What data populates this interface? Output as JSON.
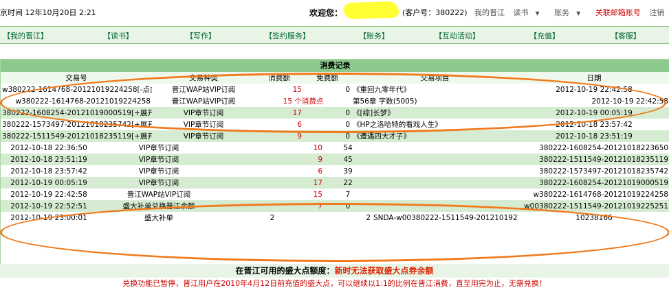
{
  "header": {
    "left_text": "京时间  12年10月20日  2:21",
    "welcome": "欢迎您：",
    "customer": "(客户号：380222)",
    "links": [
      "我的晋江",
      "读书",
      "账务",
      "关联邮箱账号",
      "注销"
    ]
  },
  "nav": [
    "【我的晋江】",
    "【读书】",
    "【写作】",
    "【签约服务】",
    "【账务】",
    "【互动活动】",
    "【充值】",
    "【客服】"
  ],
  "section": {
    "title": "消费记录",
    "headers": [
      "交易号",
      "交易种类",
      "消费额",
      "免费额",
      "交易项目",
      "日期"
    ],
    "records": [
      {
        "id": "w380222-1614768-20121019224258[-点击收起]",
        "type": "晋江WAP站VIP订阅",
        "spend": "15",
        "free": "0",
        "item": "《重回九零年代》",
        "date": "2012-10-19 22:42:58"
      },
      {
        "id": "w380222-1614768-20121019224258",
        "type": "晋江WAP站VIP订阅",
        "spend": "15 个消费点",
        "free": "",
        "item": "第56章  字数(5005)",
        "date": "2012-10-19 22:42:58"
      },
      {
        "id": "380222-1608254-20121019000519[+展开细节]",
        "type": "VIP章节订阅",
        "spend": "17",
        "free": "0",
        "item": "《[综]长梦》",
        "date": "2012-10-19 00:05:19"
      },
      {
        "id": "380222-1573497-20121018235742[+展开细节]",
        "type": "VIP章节订阅",
        "spend": "6",
        "free": "0",
        "item": "《HP之洛哈特的看戏人生》",
        "date": "2012-10-18 23:57:42"
      },
      {
        "id": "380222-1511549-20121018235119[+展开细节]",
        "type": "VIP章节订阅",
        "spend": "9",
        "free": "0",
        "item": "《遭遇四大才子》",
        "date": "2012-10-18 23:51:19"
      }
    ],
    "ledger": [
      {
        "date": "2012-10-18 22:36:50",
        "type": "VIP章节订阅",
        "spend": "10",
        "balance": "54",
        "id": "380222-1608254-20121018223650"
      },
      {
        "date": "2012-10-18 23:51:19",
        "type": "VIP章节订阅",
        "spend": "9",
        "balance": "45",
        "id": "380222-1511549-20121018235119"
      },
      {
        "date": "2012-10-18 23:57:42",
        "type": "VIP章节订阅",
        "spend": "6",
        "balance": "39",
        "id": "380222-1573497-20121018235742"
      },
      {
        "date": "2012-10-19 00:05:19",
        "type": "VIP章节订阅",
        "spend": "17",
        "balance": "22",
        "id": "380222-1608254-20121019000519"
      },
      {
        "date": "2012-10-19 22:42:58",
        "type": "晋江WAP站VIP订阅",
        "spend": "15",
        "balance": "7",
        "id": "w380222-1614768-20121019224258"
      },
      {
        "date": "2012-10-19 22:52:51",
        "type": "盛大补单兑换晋江余额",
        "spend": "7",
        "balance": "0",
        "id": "w00380222-1511549-20121019225251"
      }
    ],
    "last_row": {
      "date": "2012-10-19 23:00:01",
      "type": "盛大补单",
      "a": "2",
      "b": "2",
      "id": "SNDA-w00380222-1511549-20121019225251",
      "extra": "10238166"
    }
  },
  "bottom": {
    "line1_black": "在晋江可用的盛大点额度：",
    "line1_red": "新时无法获取盛大点券余额",
    "line2": "兑换功能已暂停，晋江用户在2010年4月12日前充值的盛大点，可以继续以1:1的比例在晋江消费，直至用完为止，无需兑换！"
  },
  "colors": {
    "annotation": "#f07a1c",
    "header_green": "#8cc98c",
    "row_green": "#d6ecd2",
    "red_text": "#cc0000"
  }
}
